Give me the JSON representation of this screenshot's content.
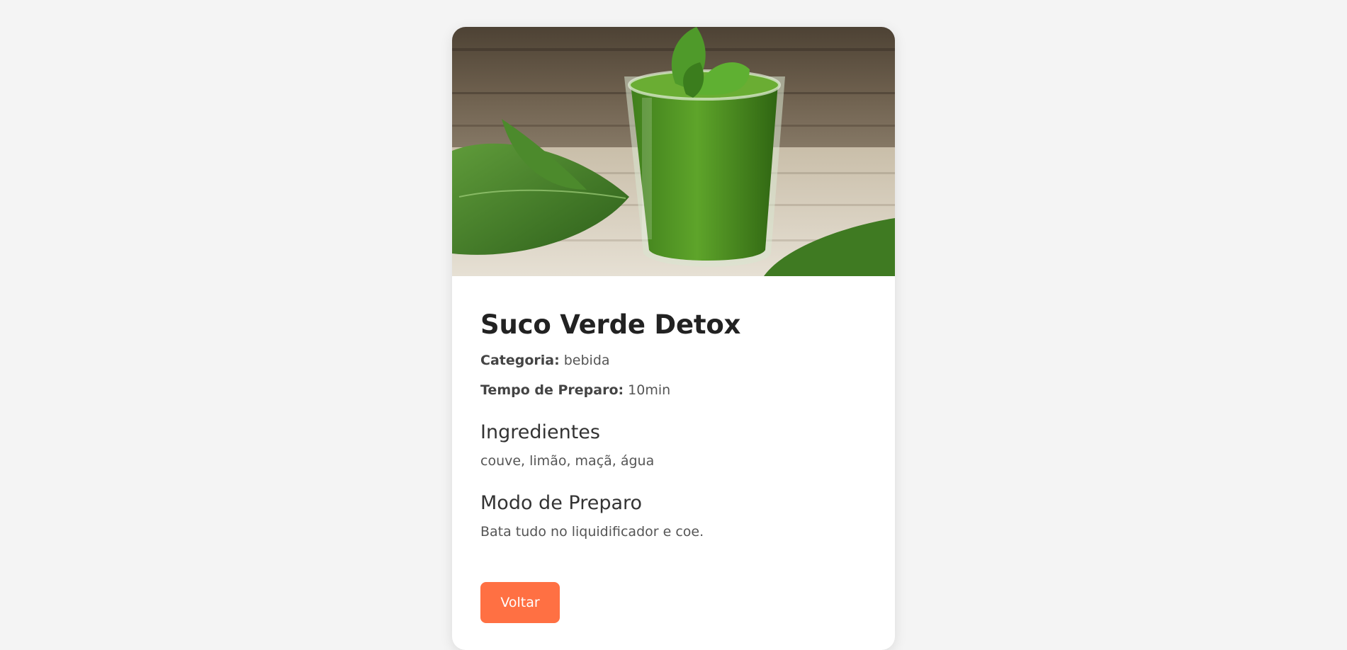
{
  "recipe": {
    "title": "Suco Verde Detox",
    "category_label": "Categoria:",
    "category_value": "bebida",
    "time_label": "Tempo de Preparo:",
    "time_value": "10min",
    "ingredients_heading": "Ingredientes",
    "ingredients_text": "couve, limão, maçã, água",
    "method_heading": "Modo de Preparo",
    "method_text": "Bata tudo no liquidificador e coe."
  },
  "actions": {
    "back_label": "Voltar"
  },
  "colors": {
    "background": "#f4f4f4",
    "card": "#ffffff",
    "accent": "#ff7043",
    "title": "#222222",
    "text": "#555555"
  },
  "image": {
    "subject": "green-smoothie-glass-with-spinach"
  }
}
